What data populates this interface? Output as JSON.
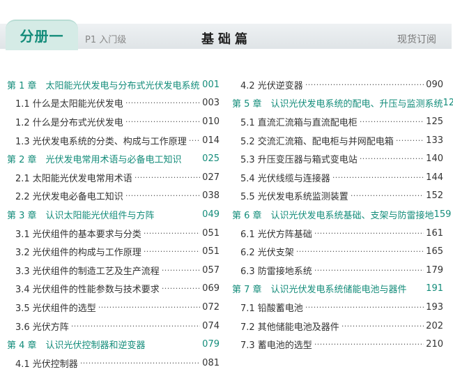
{
  "header": {
    "tab": "分册一",
    "level": "P1 入门级",
    "title": "基础篇",
    "right": "现货订阅"
  },
  "toc": {
    "left": [
      {
        "kind": "chapter",
        "label": "第 1 章　太阳能光伏发电与分布式光伏发电系统",
        "page": "001"
      },
      {
        "kind": "section",
        "label": "1.1 什么是太阳能光伏发电",
        "page": "003"
      },
      {
        "kind": "section",
        "label": "1.2 什么是分布式光伏发电",
        "page": "010"
      },
      {
        "kind": "section",
        "label": "1.3 光伏发电系统的分类、构成与工作原理",
        "page": "014"
      },
      {
        "kind": "chapter",
        "label": "第 2 章　光伏发电常用术语与必备电工知识",
        "page": "025"
      },
      {
        "kind": "section",
        "label": "2.1 太阳能光伏发电常用术语",
        "page": "027"
      },
      {
        "kind": "section",
        "label": "2.2 光伏发电必备电工知识",
        "page": "038"
      },
      {
        "kind": "chapter",
        "label": "第 3 章　认识太阳能光伏组件与方阵",
        "page": "049"
      },
      {
        "kind": "section",
        "label": "3.1 光伏组件的基本要求与分类",
        "page": "051"
      },
      {
        "kind": "section",
        "label": "3.2 光伏组件的构成与工作原理",
        "page": "051"
      },
      {
        "kind": "section",
        "label": "3.3 光伏组件的制造工艺及生产流程",
        "page": "057"
      },
      {
        "kind": "section",
        "label": "3.4 光伏组件的性能参数与技术要求",
        "page": "069"
      },
      {
        "kind": "section",
        "label": "3.5 光伏组件的选型",
        "page": "072"
      },
      {
        "kind": "section",
        "label": "3.6 光伏方阵",
        "page": "074"
      },
      {
        "kind": "chapter",
        "label": "第 4 章　认识光伏控制器和逆变器",
        "page": "079"
      },
      {
        "kind": "section",
        "label": "4.1 光伏控制器",
        "page": "081"
      }
    ],
    "right": [
      {
        "kind": "section",
        "label": "4.2 光伏逆变器",
        "page": "090"
      },
      {
        "kind": "chapter",
        "label": "第 5 章　认识光伏发电系统的配电、升压与监测系统",
        "page": "123"
      },
      {
        "kind": "section",
        "label": "5.1 直流汇流箱与直流配电柜",
        "page": "125"
      },
      {
        "kind": "section",
        "label": "5.2 交流汇流箱、配电柜与并网配电箱",
        "page": "133"
      },
      {
        "kind": "section",
        "label": "5.3 升压变压器与箱式变电站",
        "page": "140"
      },
      {
        "kind": "section",
        "label": "5.4 光伏线缆与连接器",
        "page": "144"
      },
      {
        "kind": "section",
        "label": "5.5 光伏发电系统监测装置",
        "page": "152"
      },
      {
        "kind": "chapter",
        "label": "第 6 章　认识光伏发电系统基础、支架与防雷接地",
        "page": "159"
      },
      {
        "kind": "section",
        "label": "6.1 光伏方阵基础",
        "page": "161"
      },
      {
        "kind": "section",
        "label": "6.2 光伏支架",
        "page": "165"
      },
      {
        "kind": "section",
        "label": "6.3 防雷接地系统",
        "page": "179"
      },
      {
        "kind": "chapter",
        "label": "第 7 章　认识光伏发电系统储能电池与器件",
        "page": "191"
      },
      {
        "kind": "section",
        "label": "7.1 铅酸蓄电池",
        "page": "193"
      },
      {
        "kind": "section",
        "label": "7.2 其他储能电池及器件",
        "page": "202"
      },
      {
        "kind": "section",
        "label": "7.3 蓄电池的选型",
        "page": "210"
      }
    ]
  }
}
